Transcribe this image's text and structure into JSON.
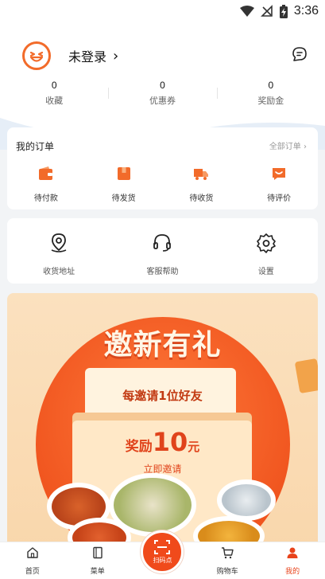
{
  "status_bar": {
    "time": "3:36",
    "icons": [
      "wifi-icon",
      "no-signal-icon",
      "battery-charging-icon"
    ]
  },
  "profile": {
    "login_text": "未登录",
    "chevron": "›"
  },
  "stats": [
    {
      "value": "0",
      "label": "收藏"
    },
    {
      "value": "0",
      "label": "优惠券"
    },
    {
      "value": "0",
      "label": "奖励金"
    }
  ],
  "orders": {
    "title": "我的订单",
    "all_label": "全部订单 ›",
    "items": [
      {
        "label": "待付款",
        "icon": "wallet-icon"
      },
      {
        "label": "待发货",
        "icon": "package-icon"
      },
      {
        "label": "待收货",
        "icon": "delivery-truck-icon"
      },
      {
        "label": "待评价",
        "icon": "review-icon"
      }
    ]
  },
  "services": [
    {
      "label": "收货地址",
      "icon": "location-pin-icon"
    },
    {
      "label": "客服帮助",
      "icon": "headset-icon"
    },
    {
      "label": "设置",
      "icon": "settings-gear-icon"
    }
  ],
  "promo": {
    "headline": "邀新有礼",
    "invite_text": "每邀请1位好友",
    "reward_prefix": "奖励",
    "reward_amount": "10",
    "reward_unit": "元",
    "cta": "立即邀请"
  },
  "tabbar": [
    {
      "label": "首页",
      "icon": "home-icon"
    },
    {
      "label": "菜单",
      "icon": "menu-book-icon"
    },
    {
      "label": "扫码点",
      "icon": "scan-icon"
    },
    {
      "label": "购物车",
      "icon": "cart-icon"
    },
    {
      "label": "我的",
      "icon": "user-icon",
      "active": true
    }
  ],
  "colors": {
    "accent": "#f04a1b",
    "brand_orange": "#f26b2a"
  }
}
